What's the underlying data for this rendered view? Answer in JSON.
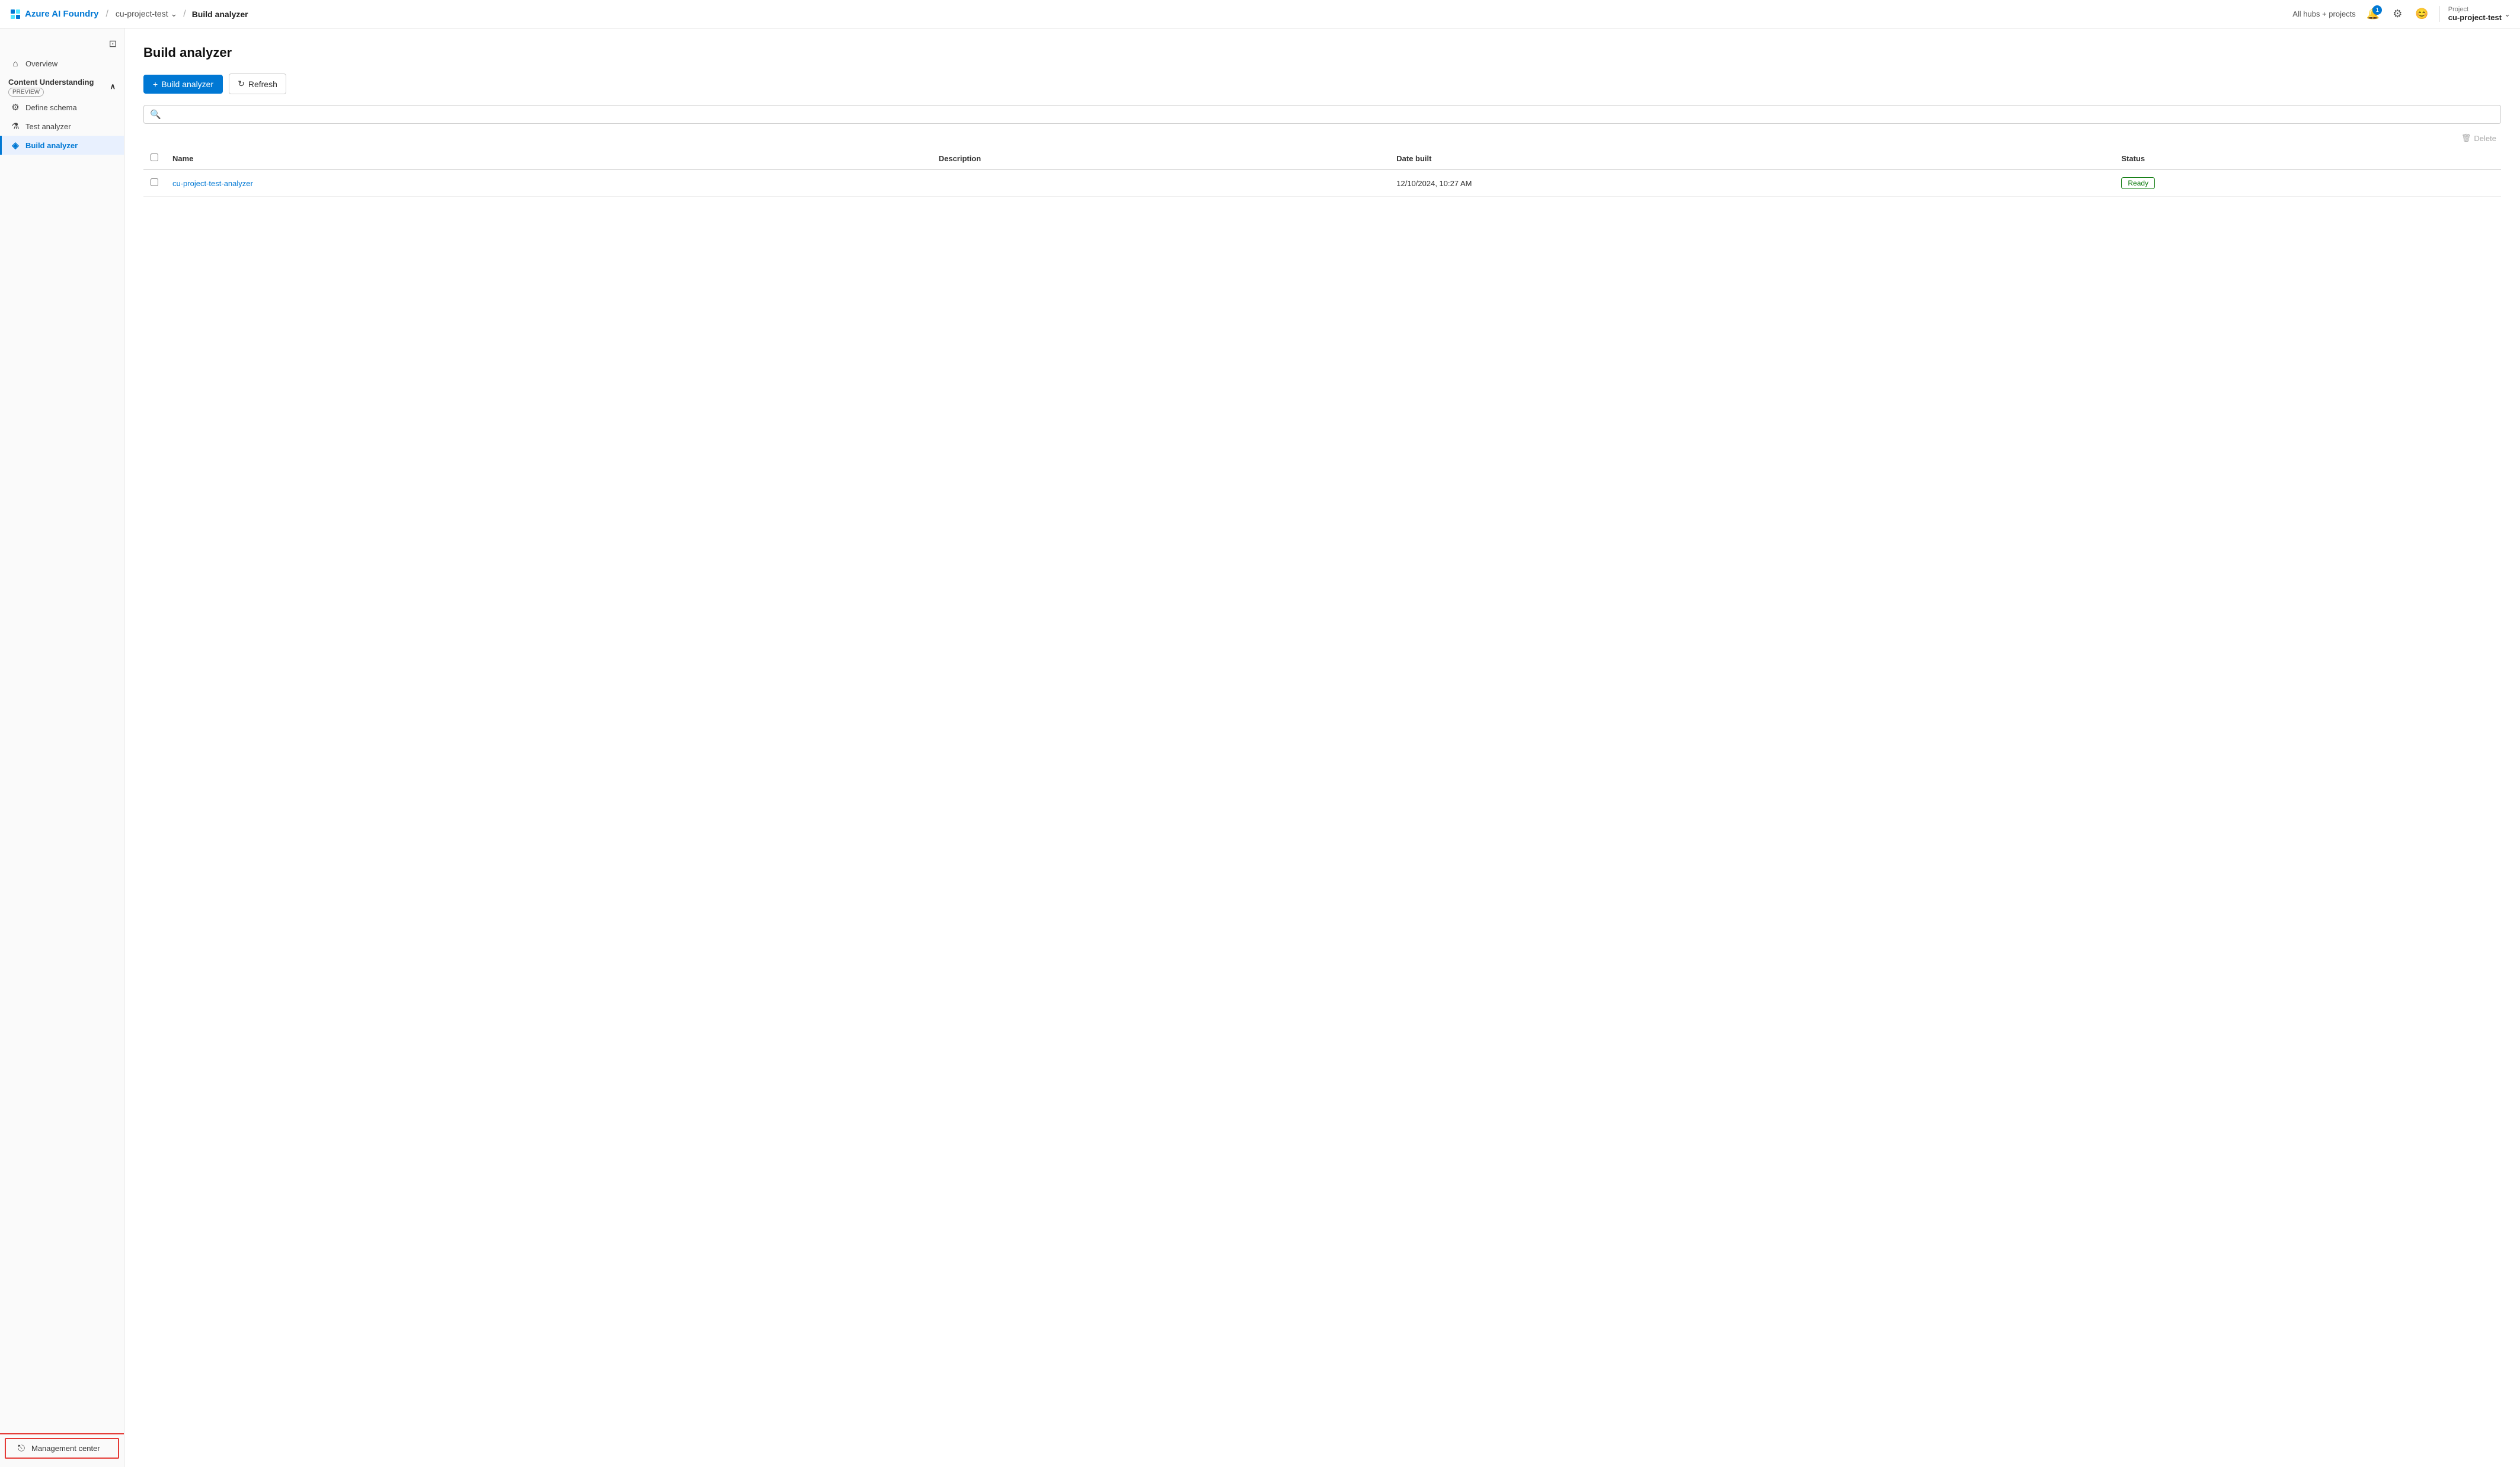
{
  "topbar": {
    "logo_text": "Azure AI Foundry",
    "breadcrumb": [
      {
        "label": "cu-project-test",
        "has_arrow": true
      },
      {
        "label": "Build analyzer",
        "is_current": true
      }
    ],
    "all_hubs_label": "All hubs + projects",
    "notification_count": "1",
    "project_label": "Project",
    "project_name": "cu-project-test"
  },
  "sidebar": {
    "toggle_icon": "☰",
    "overview_label": "Overview",
    "section_label": "Content Understanding",
    "preview_badge": "PREVIEW",
    "chevron_icon": "∧",
    "items": [
      {
        "id": "define-schema",
        "label": "Define schema",
        "icon": "⚙"
      },
      {
        "id": "test-analyzer",
        "label": "Test analyzer",
        "icon": "⚗"
      },
      {
        "id": "build-analyzer",
        "label": "Build analyzer",
        "icon": "🔷",
        "active": true
      }
    ],
    "management_center_label": "Management center",
    "management_icon": "→"
  },
  "main": {
    "page_title": "Build analyzer",
    "toolbar": {
      "build_button": "Build analyzer",
      "build_icon": "+",
      "refresh_button": "Refresh",
      "refresh_icon": "↻"
    },
    "search_placeholder": "",
    "delete_label": "Delete",
    "table": {
      "columns": [
        "Name",
        "Description",
        "Date built",
        "Status"
      ],
      "rows": [
        {
          "name": "cu-project-test-analyzer",
          "description": "",
          "date_built": "12/10/2024, 10:27 AM",
          "status": "Ready",
          "status_class": "status-ready"
        }
      ]
    }
  }
}
